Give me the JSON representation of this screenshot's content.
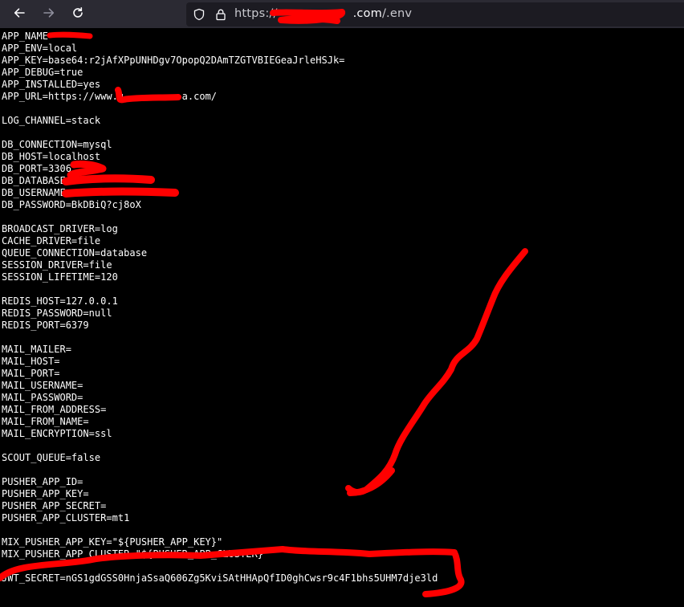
{
  "browser": {
    "url_prefix": "https://",
    "url_host_visible": ".com",
    "url_path": "/.env"
  },
  "icons": {
    "back": "arrow-left-icon",
    "forward": "arrow-right-icon",
    "reload": "reload-icon",
    "tracking": "shield-icon",
    "lock": "lock-icon"
  },
  "env_lines": [
    "APP_NAME=",
    "APP_ENV=local",
    "APP_KEY=base64:r2jAfXPpUNHDgv7OpopQ2DAmTZGTVBIEGeaJrleHSJk=",
    "APP_DEBUG=true",
    "APP_INSTALLED=yes",
    "APP_URL=https://www.g          a.com/",
    "",
    "LOG_CHANNEL=stack",
    "",
    "DB_CONNECTION=mysql",
    "DB_HOST=localhost",
    "DB_PORT=3306",
    "DB_DATABASE=",
    "DB_USERNAME=",
    "DB_PASSWORD=BkDBiQ?cj8oX",
    "",
    "BROADCAST_DRIVER=log",
    "CACHE_DRIVER=file",
    "QUEUE_CONNECTION=database",
    "SESSION_DRIVER=file",
    "SESSION_LIFETIME=120",
    "",
    "REDIS_HOST=127.0.0.1",
    "REDIS_PASSWORD=null",
    "REDIS_PORT=6379",
    "",
    "MAIL_MAILER=",
    "MAIL_HOST=",
    "MAIL_PORT=",
    "MAIL_USERNAME=",
    "MAIL_PASSWORD=",
    "MAIL_FROM_ADDRESS=",
    "MAIL_FROM_NAME=",
    "MAIL_ENCRYPTION=ssl",
    "",
    "SCOUT_QUEUE=false",
    "",
    "PUSHER_APP_ID=",
    "PUSHER_APP_KEY=",
    "PUSHER_APP_SECRET=",
    "PUSHER_APP_CLUSTER=mt1",
    "",
    "MIX_PUSHER_APP_KEY=\"${PUSHER_APP_KEY}\"",
    "MIX_PUSHER_APP_CLUSTER=\"${PUSHER_APP_CLUSTER}\"",
    "",
    "JWT_SECRET=nGS1gdGSS0HnjaSsaQ606Zg5KviSAtHHApQfID0ghCwsr9c4F1bhs5UHM7dje3ld"
  ],
  "colors": {
    "background": "#000000",
    "text": "#ffffff",
    "toolbar": "#2b2a33",
    "urlbar": "#1c1b22",
    "redaction": "#ff0000"
  }
}
